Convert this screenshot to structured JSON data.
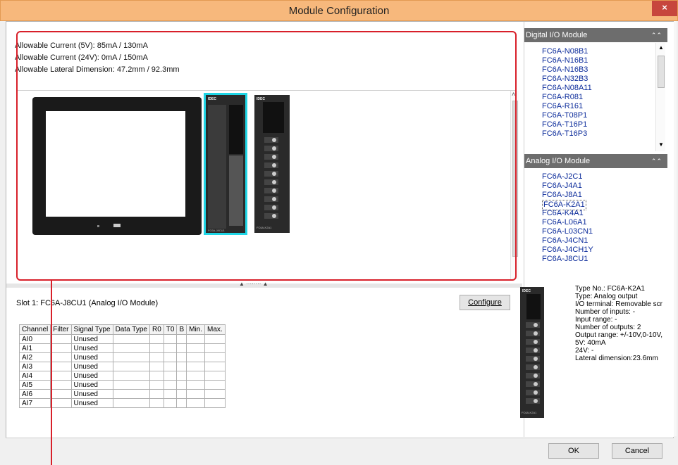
{
  "window": {
    "title": "Module Configuration",
    "close_glyph": "×"
  },
  "info": {
    "current_5v": "Allowable Current (5V): 85mA / 130mA",
    "current_24v": "Allowable Current (24V): 0mA / 150mA",
    "lateral": "Allowable Lateral Dimension: 47.2mm / 92.3mm"
  },
  "modules_canvas": {
    "modules": [
      {
        "header": "IDEC",
        "footer": "FC6A-J8CU1"
      },
      {
        "header": "IDEC",
        "footer": "FC6A-K2A1"
      }
    ]
  },
  "slot": {
    "label": "Slot 1: FC6A-J8CU1 (Analog I/O Module)",
    "configure_label": "Configure"
  },
  "channel_table": {
    "headers": [
      "Channel",
      "Filter",
      "Signal Type",
      "Data Type",
      "R0",
      "T0",
      "B",
      "Min.",
      "Max."
    ],
    "rows": [
      [
        "AI0",
        "",
        "Unused",
        "",
        "",
        "",
        "",
        "",
        ""
      ],
      [
        "AI1",
        "",
        "Unused",
        "",
        "",
        "",
        "",
        "",
        ""
      ],
      [
        "AI2",
        "",
        "Unused",
        "",
        "",
        "",
        "",
        "",
        ""
      ],
      [
        "AI3",
        "",
        "Unused",
        "",
        "",
        "",
        "",
        "",
        ""
      ],
      [
        "AI4",
        "",
        "Unused",
        "",
        "",
        "",
        "",
        "",
        ""
      ],
      [
        "AI5",
        "",
        "Unused",
        "",
        "",
        "",
        "",
        "",
        ""
      ],
      [
        "AI6",
        "",
        "Unused",
        "",
        "",
        "",
        "",
        "",
        ""
      ],
      [
        "AI7",
        "",
        "Unused",
        "",
        "",
        "",
        "",
        "",
        ""
      ]
    ]
  },
  "digital_section": {
    "title": "Digital I/O Module",
    "items": [
      "FC6A-N08B1",
      "FC6A-N16B1",
      "FC6A-N16B3",
      "FC6A-N32B3",
      "FC6A-N08A11",
      "FC6A-R081",
      "FC6A-R161",
      "FC6A-T08P1",
      "FC6A-T16P1",
      "FC6A-T16P3"
    ]
  },
  "analog_section": {
    "title": "Analog I/O Module",
    "items": [
      "FC6A-J2C1",
      "FC6A-J4A1",
      "FC6A-J8A1",
      "FC6A-K2A1",
      "FC6A-K4A1",
      "FC6A-L06A1",
      "FC6A-L03CN1",
      "FC6A-J4CN1",
      "FC6A-J4CH1Y",
      "FC6A-J8CU1"
    ],
    "selected": "FC6A-K2A1"
  },
  "preview": {
    "lines": [
      "Type No.: FC6A-K2A1",
      "Type: Analog output",
      "I/O terminal: Removable scr",
      "Number of inputs: -",
      "Input range: -",
      "Number of outputs: 2",
      "Output range: +/-10V,0-10V,",
      "5V: 40mA",
      "24V: -",
      "Lateral dimension:23.6mm"
    ]
  },
  "footer": {
    "ok_label": "OK",
    "cancel_label": "Cancel"
  },
  "colors": {
    "titlebar": "#f7b87c",
    "close": "#c7463d",
    "highlight": "#d8202a",
    "selection": "#1fd6e6"
  }
}
